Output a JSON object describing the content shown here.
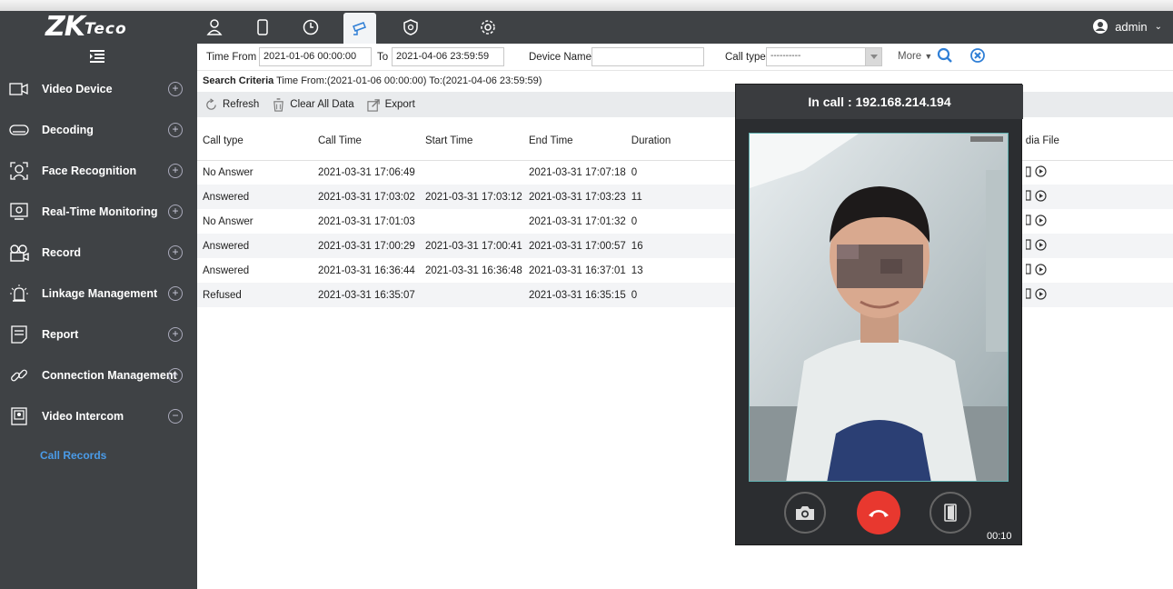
{
  "app": {
    "logo_main": "ZK",
    "logo_sub": "Teco",
    "user": "admin"
  },
  "top_icons": [
    "person-icon",
    "door-icon",
    "clock-icon",
    "camera-icon",
    "shield-icon",
    "gear-icon"
  ],
  "sidebar": {
    "items": [
      {
        "label": "Video Device",
        "icon": "video-camera-icon",
        "expanded": false
      },
      {
        "label": "Decoding",
        "icon": "decoder-icon",
        "expanded": false
      },
      {
        "label": "Face Recognition",
        "icon": "face-scan-icon",
        "expanded": false
      },
      {
        "label": "Real-Time Monitoring",
        "icon": "monitor-icon",
        "expanded": false
      },
      {
        "label": "Record",
        "icon": "record-icon",
        "expanded": false
      },
      {
        "label": "Linkage Management",
        "icon": "alarm-icon",
        "expanded": false
      },
      {
        "label": "Report",
        "icon": "report-icon",
        "expanded": false
      },
      {
        "label": "Connection Management",
        "icon": "link-icon",
        "expanded": false
      },
      {
        "label": "Video Intercom",
        "icon": "intercom-icon",
        "expanded": true
      }
    ],
    "sub_item": "Call Records"
  },
  "filter": {
    "time_from_label": "Time From",
    "time_from_value": "2021-01-06 00:00:00",
    "to_label": "To",
    "to_value": "2021-04-06 23:59:59",
    "device_name_label": "Device Name",
    "device_name_value": "",
    "call_type_label": "Call type",
    "call_type_value": "----------",
    "more_label": "More"
  },
  "criteria": {
    "label": "Search Criteria",
    "text": "Time From:(2021-01-06 00:00:00)  To:(2021-04-06 23:59:59)"
  },
  "toolbar": {
    "refresh": "Refresh",
    "clear_all": "Clear All Data",
    "export": "Export"
  },
  "table": {
    "headers": [
      "Call type",
      "Call Time",
      "Start Time",
      "End Time",
      "Duration",
      "dia File"
    ],
    "rows": [
      [
        "No Answer",
        "2021-03-31 17:06:49",
        "",
        "2021-03-31 17:07:18",
        "0"
      ],
      [
        "Answered",
        "2021-03-31 17:03:02",
        "2021-03-31 17:03:12",
        "2021-03-31 17:03:23",
        "11"
      ],
      [
        "No Answer",
        "2021-03-31 17:01:03",
        "",
        "2021-03-31 17:01:32",
        "0"
      ],
      [
        "Answered",
        "2021-03-31 17:00:29",
        "2021-03-31 17:00:41",
        "2021-03-31 17:00:57",
        "16"
      ],
      [
        "Answered",
        "2021-03-31 16:36:44",
        "2021-03-31 16:36:48",
        "2021-03-31 16:37:01",
        "13"
      ],
      [
        "Refused",
        "2021-03-31 16:35:07",
        "",
        "2021-03-31 16:35:15",
        "0"
      ]
    ]
  },
  "call": {
    "title": "In call : 192.168.214.194",
    "timer": "00:10"
  },
  "colors": {
    "dark": "#3f4245",
    "accent": "#2f7fd6",
    "link": "#4a9be8",
    "hangup": "#e8382f"
  }
}
